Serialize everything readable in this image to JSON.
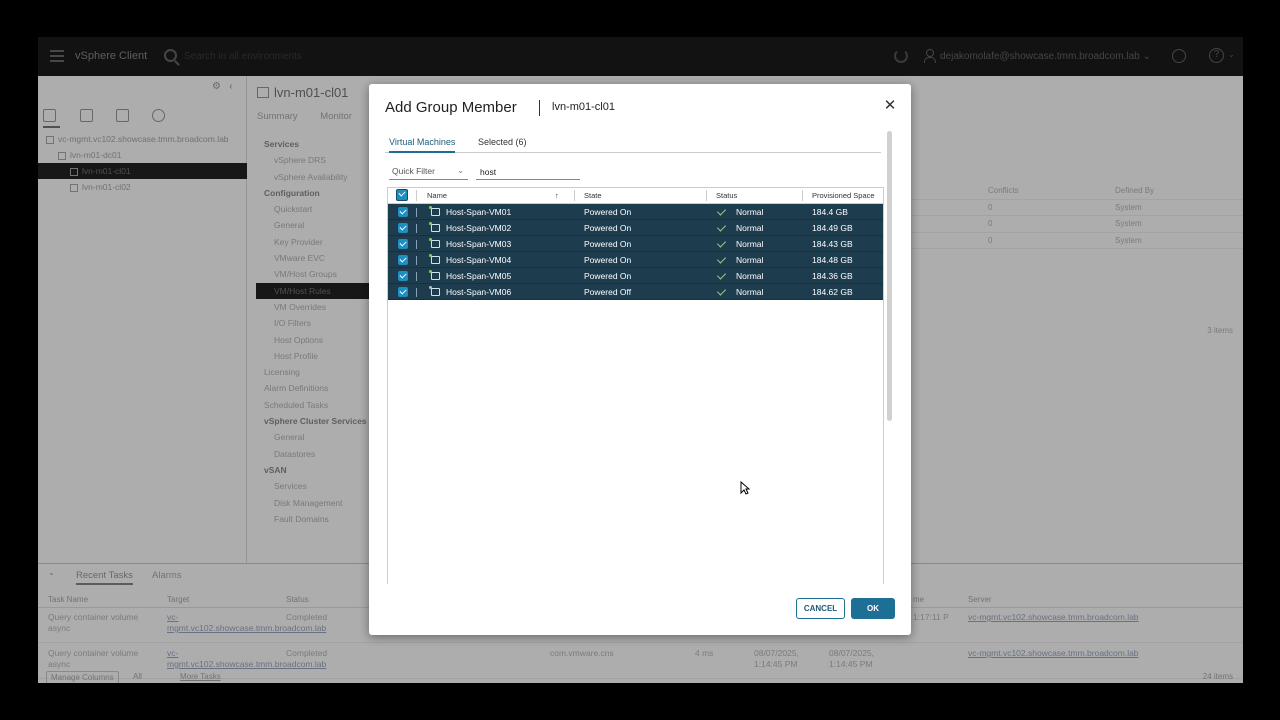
{
  "header": {
    "app_title": "vSphere Client",
    "search_placeholder": "Search in all environments",
    "user": "dejakomolafe@showcase.tmm.broadcom.lab"
  },
  "tree": [
    {
      "label": "vc-mgmt.vc102.showcase.tmm.broadcom.lab",
      "indent": 0
    },
    {
      "label": "lvn-m01-dc01",
      "indent": 1
    },
    {
      "label": "lvn-m01-cl01",
      "indent": 2,
      "selected": true
    },
    {
      "label": "lvn-m01-cl02",
      "indent": 2
    }
  ],
  "content": {
    "title": "lvn-m01-cl01",
    "tabs": [
      "Summary",
      "Monitor"
    ],
    "config_nav": [
      {
        "label": "Services",
        "hdr": true
      },
      {
        "label": "vSphere DRS"
      },
      {
        "label": "vSphere Availability"
      },
      {
        "label": "Configuration",
        "hdr": true
      },
      {
        "label": "Quickstart"
      },
      {
        "label": "General"
      },
      {
        "label": "Key Provider"
      },
      {
        "label": "VMware EVC"
      },
      {
        "label": "VM/Host Groups"
      },
      {
        "label": "VM/Host Rules",
        "sel": true
      },
      {
        "label": "VM Overrides"
      },
      {
        "label": "I/O Filters"
      },
      {
        "label": "Host Options"
      },
      {
        "label": "Host Profile"
      },
      {
        "label": "Licensing",
        "hdr2": true
      },
      {
        "label": "Alarm Definitions",
        "hdr2": true
      },
      {
        "label": "Scheduled Tasks",
        "hdr2": true
      },
      {
        "label": "vSphere Cluster Services",
        "hdr": true
      },
      {
        "label": "General"
      },
      {
        "label": "Datastores"
      },
      {
        "label": "vSAN",
        "hdr": true
      },
      {
        "label": "Services"
      },
      {
        "label": "Disk Management"
      },
      {
        "label": "Fault Domains"
      }
    ],
    "rules_table": {
      "headers": [
        "Conflicts",
        "Defined By"
      ],
      "rows": [
        [
          "0",
          "System"
        ],
        [
          "0",
          "System"
        ],
        [
          "0",
          "System"
        ]
      ],
      "count": "3 items"
    }
  },
  "tasks": {
    "tabs": [
      "Recent Tasks",
      "Alarms"
    ],
    "columns": [
      "Task Name",
      "Target",
      "Status",
      "me",
      "Server"
    ],
    "rows": [
      {
        "name": "Query container volume async",
        "target": "vc-mgmt.vc102.showcase.tmm.broadcom.lab",
        "status": "Completed",
        "initiator": "",
        "queued": "",
        "start": "",
        "completion": "1:17:11 P",
        "server": "vc-mgmt.vc102.showcase.tmm.broadcom.lab"
      },
      {
        "name": "Query container volume async",
        "target": "vc-mgmt.vc102.showcase.tmm.broadcom.lab",
        "status": "Completed",
        "initiator": "com.vmware.cns",
        "queued": "4 ms",
        "start": "08/07/2025, 1:14:45 PM",
        "completion": "08/07/2025, 1:14:45 PM",
        "server": "vc-mgmt.vc102.showcase.tmm.broadcom.lab"
      }
    ],
    "manage_columns": "Manage Columns",
    "all": "All",
    "more_tasks": "More Tasks",
    "count": "24 items"
  },
  "dialog": {
    "title": "Add Group Member",
    "subtitle": "lvn-m01-cl01",
    "tabs": [
      "Virtual Machines",
      "Selected (6)"
    ],
    "quick_filter": "Quick Filter",
    "filter_value": "host",
    "columns": [
      "Name",
      "State",
      "Status",
      "Provisioned Space"
    ],
    "vms": [
      {
        "name": "Host-Span-VM01",
        "state": "Powered On",
        "status": "Normal",
        "space": "184.4 GB",
        "on": true
      },
      {
        "name": "Host-Span-VM02",
        "state": "Powered On",
        "status": "Normal",
        "space": "184.49 GB",
        "on": true
      },
      {
        "name": "Host-Span-VM03",
        "state": "Powered On",
        "status": "Normal",
        "space": "184.43 GB",
        "on": true
      },
      {
        "name": "Host-Span-VM04",
        "state": "Powered On",
        "status": "Normal",
        "space": "184.48 GB",
        "on": true
      },
      {
        "name": "Host-Span-VM05",
        "state": "Powered On",
        "status": "Normal",
        "space": "184.36 GB",
        "on": true
      },
      {
        "name": "Host-Span-VM06",
        "state": "Powered Off",
        "status": "Normal",
        "space": "184.62 GB",
        "on": false
      }
    ],
    "cancel_label": "CANCEL",
    "ok_label": "OK"
  },
  "colors": {
    "accent": "#1e6f96",
    "selected_row": "#1d3d4f",
    "checkbox": "#1e8ec0",
    "ok_check": "#8fd07c"
  },
  "icons": [
    "menu-icon",
    "search-icon",
    "refresh-icon",
    "user-icon",
    "feedback-icon",
    "help-icon",
    "close-icon",
    "vm-icon",
    "check-icon",
    "sort-arrow-icon",
    "chevron-down-icon"
  ]
}
